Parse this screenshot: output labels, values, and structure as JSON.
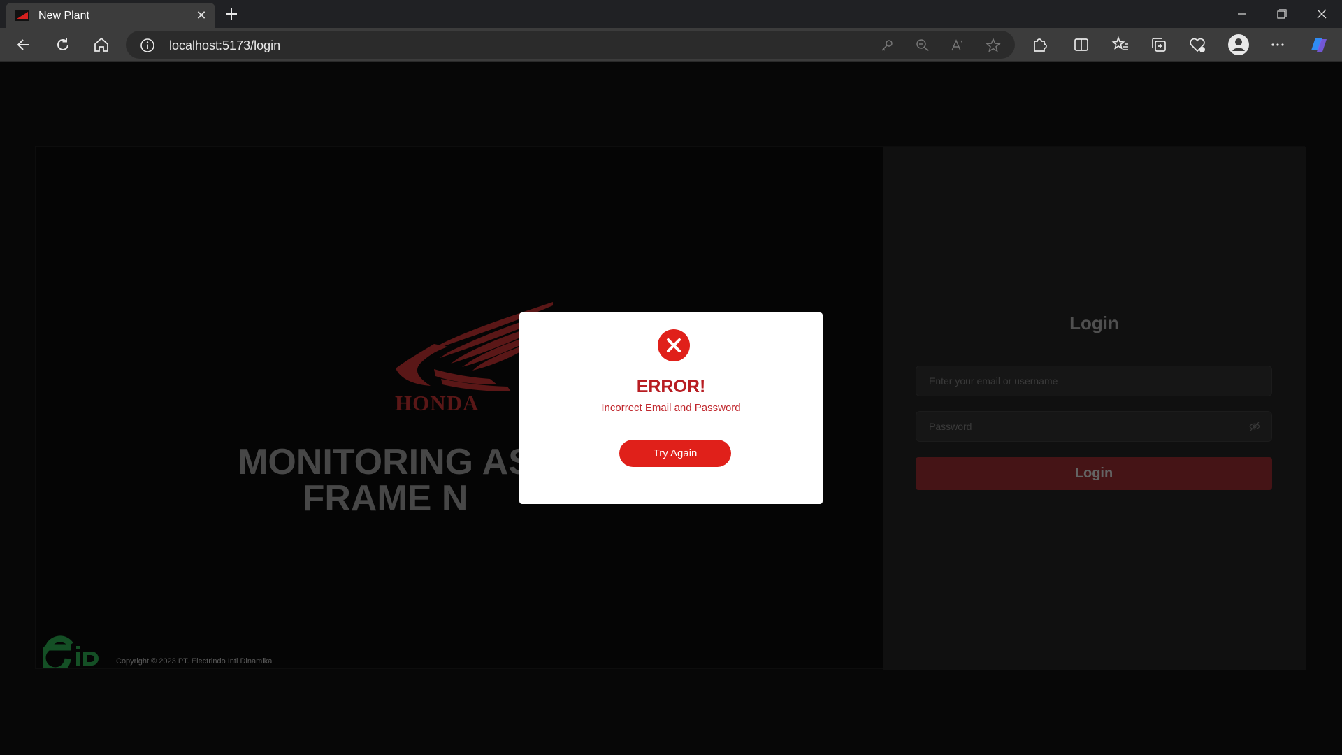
{
  "browser": {
    "tab_title": "New Plant",
    "url": "localhost:5173/login"
  },
  "hero": {
    "brand": "HONDA",
    "title_line1": "MONITORING AS",
    "title_line2": "FRAME N"
  },
  "footer": {
    "copyright": "Copyright © 2023 PT. Electrindo Inti Dinamika",
    "logo_text": "eiD"
  },
  "login": {
    "title": "Login",
    "email_placeholder": "Enter your email or username",
    "password_placeholder": "Password",
    "button_label": "Login"
  },
  "modal": {
    "title": "ERROR!",
    "message": "Incorrect Email and Password",
    "button_label": "Try Again"
  },
  "colors": {
    "brand_red": "#e0201a",
    "error_red": "#b81d22",
    "login_button": "#6b1f23"
  },
  "icons": {
    "back": "back-arrow-icon",
    "reload": "reload-icon",
    "home": "home-icon",
    "info": "site-info-icon",
    "error": "error-x-icon",
    "eye": "eye-slash-icon"
  }
}
